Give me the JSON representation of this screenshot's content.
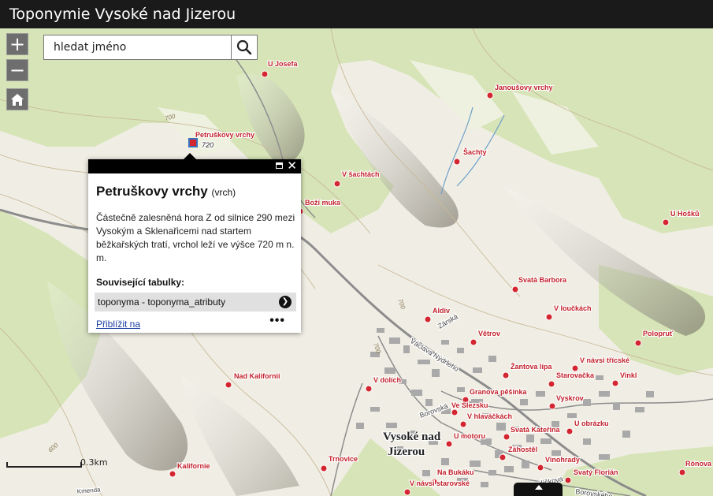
{
  "app": {
    "title": "Toponymie Vysoké nad Jizerou"
  },
  "controls": {
    "zoom_in": "+",
    "zoom_out": "−",
    "home_label": "home"
  },
  "search": {
    "placeholder": "hledat jméno"
  },
  "popup": {
    "title": "Petruškovy vrchy",
    "type": "(vrch)",
    "description": "Částečně zalesněná hora Z od silnice 290 mezi Vysokým a Sklenařicemi nad startem běžkařských tratí, vrchol leží ve výšce 720 m n. m.",
    "related_heading": "Související tabulky:",
    "related_link": "toponyma - toponyma_atributy",
    "zoom_link": "Přiblížit na",
    "more": "•••"
  },
  "scale": {
    "label": "0.3km"
  },
  "map": {
    "town_label_1": "Vysoké nad",
    "town_label_2": "Jizerou",
    "contour_labels": [
      "700",
      "700",
      "700",
      "600"
    ],
    "selected_elevation": "720",
    "road_labels": [
      "Václava Nýdrleho",
      "Zárská",
      "Havlíčkova",
      "Borovského",
      "Borovská",
      "Kmenda"
    ],
    "places": [
      {
        "name": "U Josefa"
      },
      {
        "name": "Janoušovy vrchy"
      },
      {
        "name": "Petruškovy vrchy"
      },
      {
        "name": "Šachty"
      },
      {
        "name": "V šachtách"
      },
      {
        "name": "Boží muka"
      },
      {
        "name": "U Hošků"
      },
      {
        "name": "Svatá Barbora"
      },
      {
        "name": "V loučkách"
      },
      {
        "name": "Aldiv"
      },
      {
        "name": "Větrov"
      },
      {
        "name": "Polopruť"
      },
      {
        "name": "Žantova lípa"
      },
      {
        "name": "V návsi třícské"
      },
      {
        "name": "Nad Kalifornií"
      },
      {
        "name": "V dolích"
      },
      {
        "name": "Starovačka"
      },
      {
        "name": "Vinkl"
      },
      {
        "name": "Granova pěšinka"
      },
      {
        "name": "Vyskrov"
      },
      {
        "name": "Ve Slezsku"
      },
      {
        "name": "V hlaváčkách"
      },
      {
        "name": "U obrázku"
      },
      {
        "name": "Svatá Kateřina"
      },
      {
        "name": "U motoru"
      },
      {
        "name": "Záhostěl"
      },
      {
        "name": "Kalifornie"
      },
      {
        "name": "Trnovice"
      },
      {
        "name": "Vinohrady"
      },
      {
        "name": "Rónova"
      },
      {
        "name": "Na Bukáku"
      },
      {
        "name": "Svatý Florián"
      },
      {
        "name": "V návsi starovské"
      }
    ]
  },
  "colors": {
    "forest": "#d9e6be",
    "meadow": "#eef1df",
    "marker": "#d32630",
    "label": "#c2202a"
  }
}
